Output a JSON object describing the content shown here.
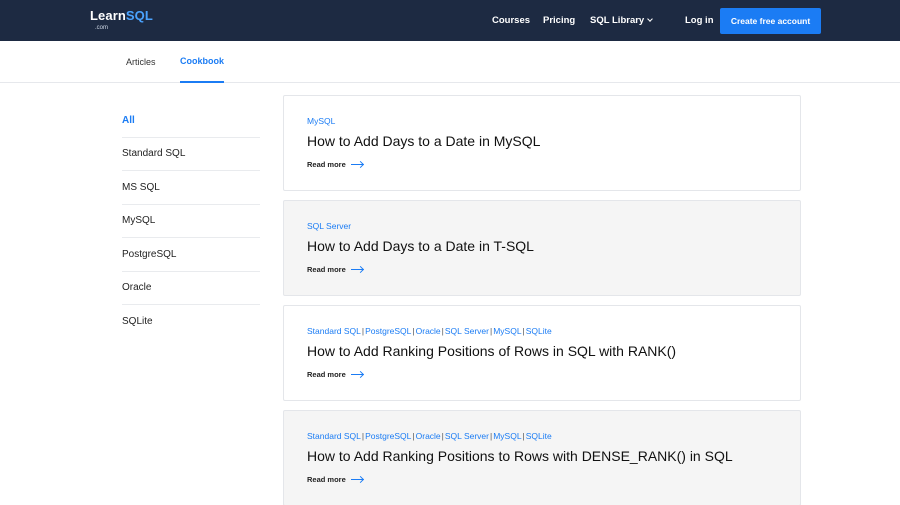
{
  "header": {
    "logo_main": "Learn",
    "logo_accent": "SQL",
    "logo_sub": ".com",
    "nav": {
      "courses": "Courses",
      "pricing": "Pricing",
      "sql_library": "SQL Library",
      "login": "Log in"
    },
    "cta": "Create free account"
  },
  "tabs": {
    "articles": "Articles",
    "cookbook": "Cookbook"
  },
  "sidebar": {
    "items": [
      "All",
      "Standard SQL",
      "MS SQL",
      "MySQL",
      "PostgreSQL",
      "Oracle",
      "SQLite"
    ]
  },
  "cards": [
    {
      "tags": [
        "MySQL"
      ],
      "title": "How to Add Days to a Date in MySQL",
      "read_more": "Read more"
    },
    {
      "tags": [
        "SQL Server"
      ],
      "title": "How to Add Days to a Date in T-SQL",
      "read_more": "Read more"
    },
    {
      "tags": [
        "Standard SQL",
        "PostgreSQL",
        "Oracle",
        "SQL Server",
        "MySQL",
        "SQLite"
      ],
      "title": "How to Add Ranking Positions of Rows in SQL with RANK()",
      "read_more": "Read more"
    },
    {
      "tags": [
        "Standard SQL",
        "PostgreSQL",
        "Oracle",
        "SQL Server",
        "MySQL",
        "SQLite"
      ],
      "title": "How to Add Ranking Positions to Rows with DENSE_RANK() in SQL",
      "read_more": "Read more"
    }
  ],
  "colors": {
    "nav_bg": "#1d2a42",
    "accent": "#1b7cf4",
    "card_shaded_bg": "#f5f5f5"
  }
}
